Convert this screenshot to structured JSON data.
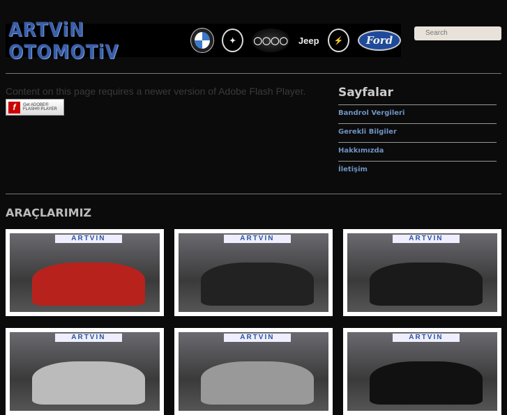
{
  "header": {
    "brand": "ARTViN OTOMOTiV",
    "logos": [
      "BMW",
      "Mercedes",
      "Audi",
      "Jeep",
      "Opel",
      "Ford"
    ],
    "search_placeholder": "Search"
  },
  "flash": {
    "message": "Content on this page requires a newer version of Adobe Flash Player.",
    "badge_line1": "Get ADOBE®",
    "badge_line2": "FLASH® PLAYER"
  },
  "sidebar": {
    "title": "Sayfalar",
    "items": [
      {
        "label": "Bandrol Vergileri"
      },
      {
        "label": "Gerekli Bilgiler"
      },
      {
        "label": "Hakkımızda"
      },
      {
        "label": "İletişim"
      }
    ]
  },
  "gallery": {
    "title": "ARAÇLARIMIZ",
    "sign": "ARTVIN",
    "items": [
      {
        "car_color": "#b8221c"
      },
      {
        "car_color": "#222"
      },
      {
        "car_color": "#1a1a1a"
      },
      {
        "car_color": "#bbb"
      },
      {
        "car_color": "#999"
      },
      {
        "car_color": "#111"
      }
    ]
  }
}
